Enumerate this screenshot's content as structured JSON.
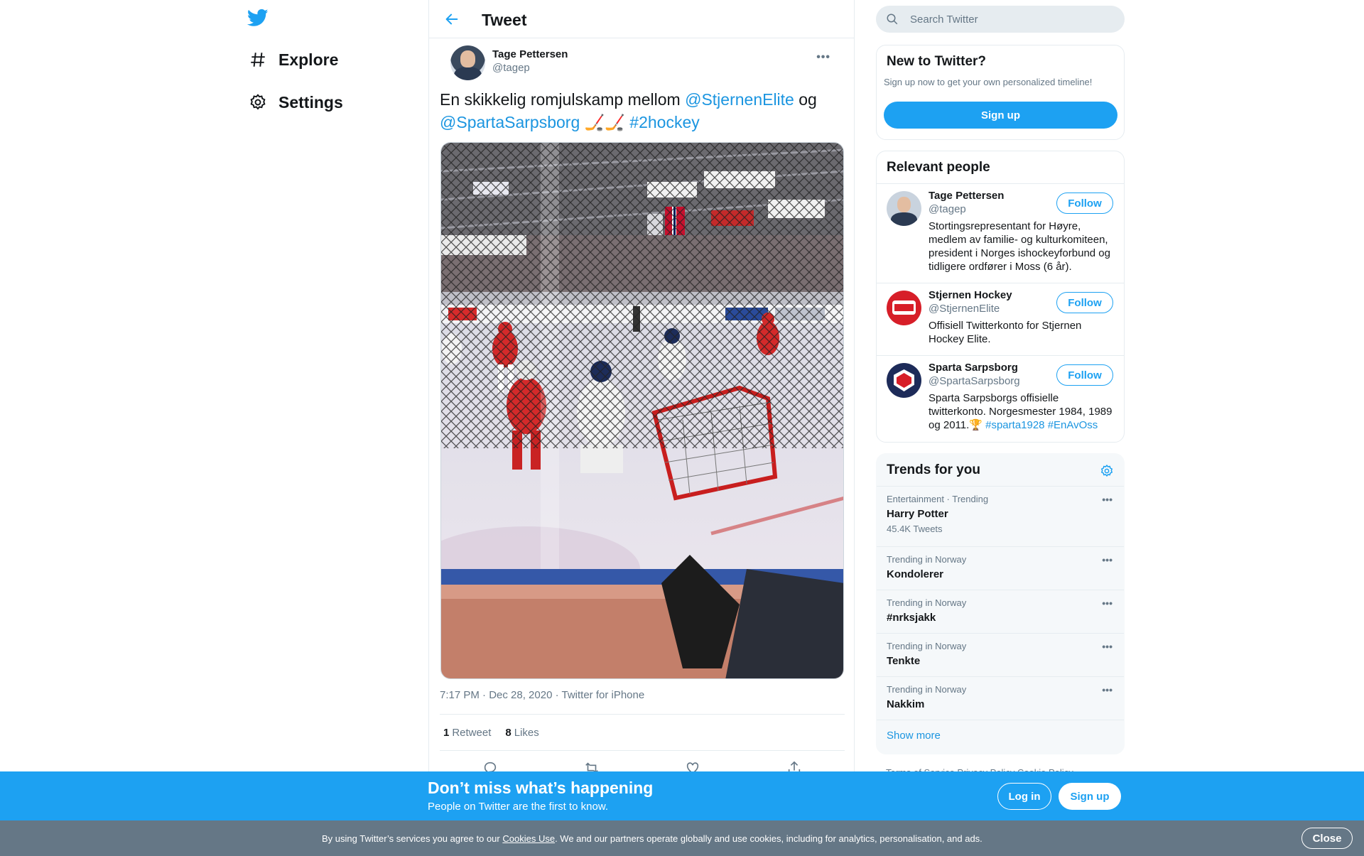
{
  "nav": {
    "explore_label": "Explore",
    "settings_label": "Settings"
  },
  "main": {
    "header_title": "Tweet",
    "tweet": {
      "author_name": "Tage Pettersen",
      "author_handle": "@tagep",
      "text_plain_1": "En skikkelig romjulskamp mellom ",
      "mention_1": "@StjernenElite",
      "text_plain_2": " og",
      "mention_2": "@SpartaSarpsborg",
      "emoji": " 🏒🏒 ",
      "hashtag": "#2hockey",
      "timestamp": "7:17 PM · Dec 28, 2020 · Twitter for iPhone",
      "retweet_count": "1",
      "retweet_label": "Retweet",
      "like_count": "8",
      "like_label": "Likes"
    }
  },
  "search": {
    "placeholder": "Search Twitter"
  },
  "new_card": {
    "title": "New to Twitter?",
    "subtitle": "Sign up now to get your own personalized timeline!",
    "signup_label": "Sign up"
  },
  "people": {
    "title": "Relevant people",
    "follow_label": "Follow",
    "items": [
      {
        "name": "Tage Pettersen",
        "handle": "@tagep",
        "bio": "Stortingsrepresentant for Høyre, medlem av familie- og kulturkomiteen, president i Norges ishockeyforbund og tidligere ordfører i Moss (6 år)."
      },
      {
        "name": "Stjernen Hockey",
        "handle": "@StjernenElite",
        "bio": "Offisiell Twitterkonto for Stjernen Hockey Elite."
      },
      {
        "name": "Sparta Sarpsborg",
        "handle": "@SpartaSarpsborg",
        "bio": "Sparta Sarpsborgs offisielle twitterkonto. Norgesmester 1984, 1989 og 2011.🏆",
        "bio_tags": "#sparta1928 #EnAvOss"
      }
    ]
  },
  "trends": {
    "title": "Trends for you",
    "items": [
      {
        "context": "Entertainment · Trending",
        "name": "Harry Potter",
        "count": "45.4K Tweets"
      },
      {
        "context": "Trending in Norway",
        "name": "Kondolerer",
        "count": ""
      },
      {
        "context": "Trending in Norway",
        "name": "#nrksjakk",
        "count": ""
      },
      {
        "context": "Trending in Norway",
        "name": "Tenkte",
        "count": ""
      },
      {
        "context": "Trending in Norway",
        "name": "Nakkim",
        "count": ""
      }
    ],
    "show_more": "Show more"
  },
  "footer": {
    "links": "Terms of Service   Privacy Policy   Cookie Policy"
  },
  "bottom_bar": {
    "title": "Don’t miss what’s happening",
    "subtitle": "People on Twitter are the first to know.",
    "login_label": "Log in",
    "signup_label": "Sign up"
  },
  "cookie_bar": {
    "text_1": "By using Twitter’s services you agree to our ",
    "link": "Cookies Use",
    "text_2": ". We and our partners operate globally and use cookies, including for analytics, personalisation, and ads.",
    "close_label": "Close"
  },
  "colors": {
    "brand": "#1da1f2",
    "link": "#1b95e0",
    "muted": "#657786",
    "cookie_bar": "#657786"
  },
  "icons": [
    "twitter-logo-icon",
    "hashtag-icon",
    "gear-icon",
    "back-arrow-icon",
    "search-icon",
    "reply-icon",
    "retweet-icon",
    "like-icon",
    "share-icon",
    "more-dots-icon"
  ]
}
